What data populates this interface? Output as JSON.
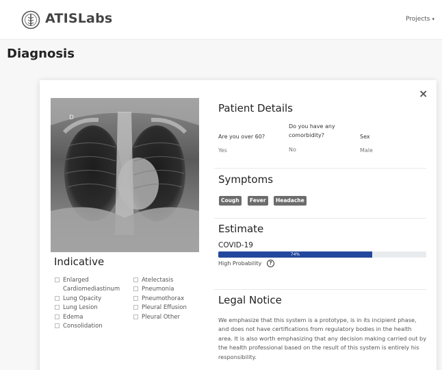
{
  "header": {
    "brand": "ATISLabs",
    "projects_label": "Projects",
    "projects_caret": "▾"
  },
  "page": {
    "title": "Diagnosis"
  },
  "modal": {
    "close_label": "×"
  },
  "indicative": {
    "title": "Indicative",
    "left_items": [
      "Enlarged",
      "Cardiomediastinum",
      "Lung Opacity",
      "Lung Lesion",
      "Edema",
      "Consolidation"
    ],
    "right_items": [
      "Atelectasis",
      "Pneumonia",
      "Pneumothorax",
      "Pleural Effusion",
      "Pleural Other"
    ]
  },
  "patient": {
    "title": "Patient Details",
    "q_age": "Are you over 60?",
    "a_age": "Yes",
    "q_comorbidity_line1": "Do you have any",
    "q_comorbidity_line2": "comorbidity?",
    "a_comorbidity": "No",
    "q_sex": "Sex",
    "a_sex": "Male"
  },
  "symptoms": {
    "title": "Symptoms",
    "items": [
      "Cough",
      "Fever",
      "Headache"
    ]
  },
  "estimate": {
    "title": "Estimate",
    "name": "COVID-19",
    "progress": 0.74,
    "progress_label": "74%",
    "probability_label": "High Probability",
    "help_icon": "?",
    "progress_color": "#23479c"
  },
  "legal": {
    "title": "Legal Notice",
    "text": "We emphasize that this system is a prototype, is in its incipient phase, and does not have certifications from regulatory bodies in the health area. It is also worth emphasizing that any decision making carried out by the health professional based on the result of this system is entirely his responsibility."
  }
}
